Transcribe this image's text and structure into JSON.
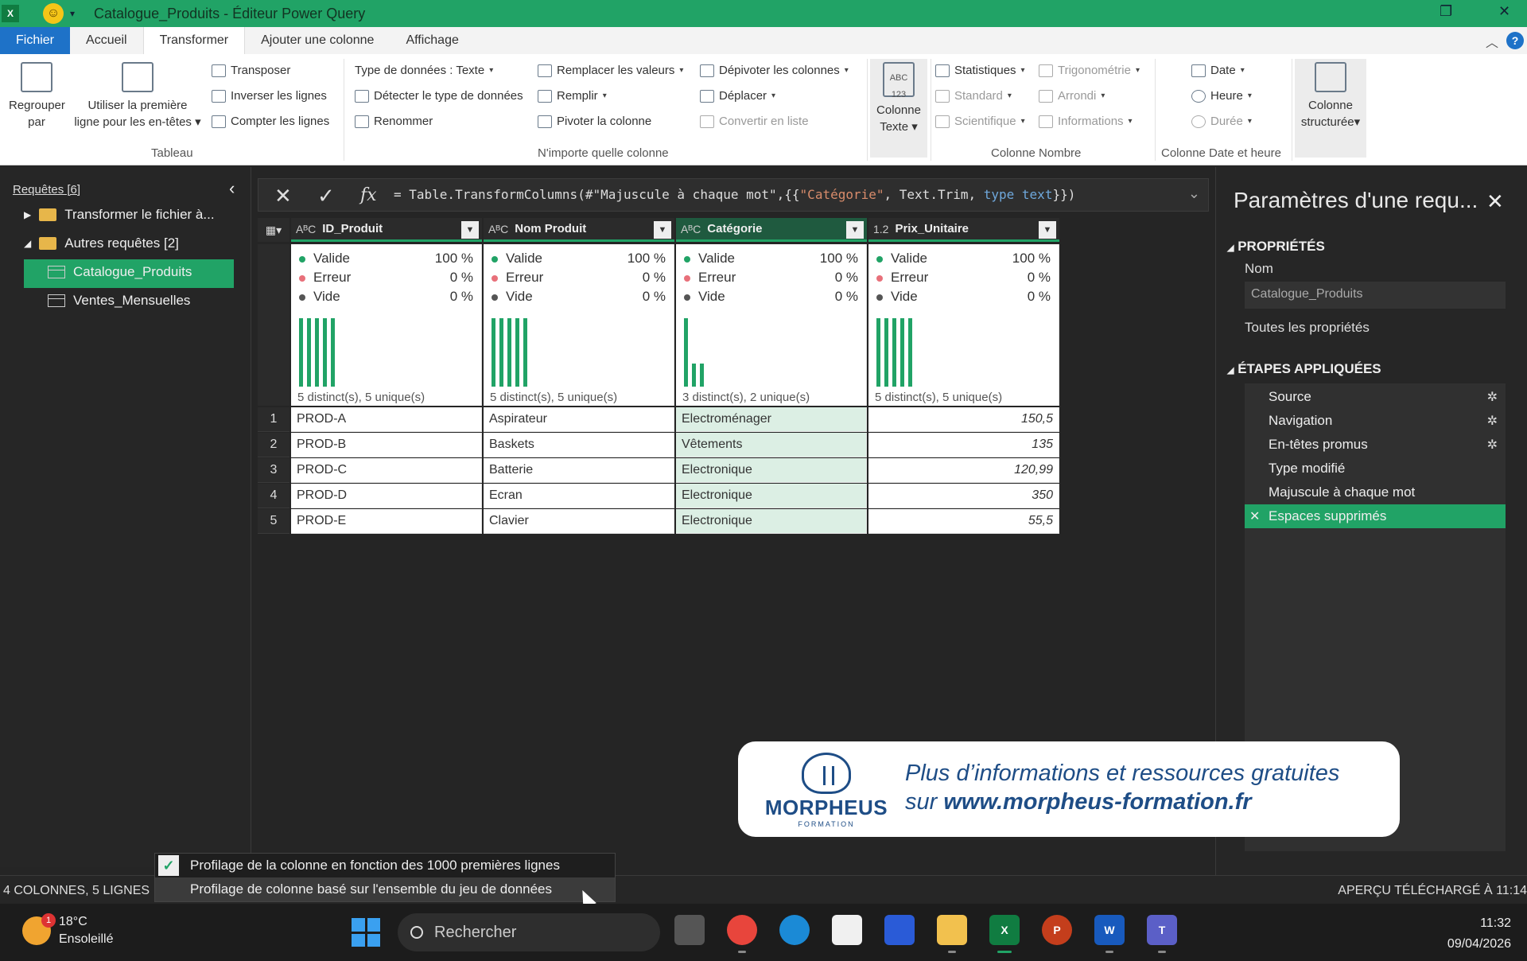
{
  "window": {
    "title": "Catalogue_Produits - Éditeur Power Query"
  },
  "tabs": [
    "Fichier",
    "Accueil",
    "Transformer",
    "Ajouter une colonne",
    "Affichage"
  ],
  "ribbon": {
    "regrouper": "Regrouper par",
    "premiere_ligne_1": "Utiliser la première",
    "premiere_ligne_2": "ligne pour les en-têtes",
    "transposer": "Transposer",
    "inverser": "Inverser les lignes",
    "compter": "Compter les lignes",
    "group_tableau": "Tableau",
    "type_donnees": "Type de données : Texte",
    "detecter": "Détecter le type de données",
    "renommer": "Renommer",
    "remplacer": "Remplacer les valeurs",
    "remplir": "Remplir",
    "pivoter": "Pivoter la colonne",
    "depivoter": "Dépivoter les colonnes",
    "deplacer": "Déplacer",
    "convertir": "Convertir en liste",
    "group_any": "N'importe quelle colonne",
    "colonne_texte_1": "Colonne",
    "colonne_texte_2": "Texte",
    "statistiques": "Statistiques",
    "standard": "Standard",
    "scientifique": "Scientifique",
    "trigonometrie": "Trigonométrie",
    "arrondi": "Arrondi",
    "informations": "Informations",
    "group_nombre": "Colonne Nombre",
    "date": "Date",
    "heure": "Heure",
    "duree": "Durée",
    "group_date": "Colonne Date et heure",
    "structuree_1": "Colonne",
    "structuree_2": "structurée"
  },
  "queries": {
    "header": "Requêtes [6]",
    "items": [
      {
        "label": "Transformer le fichier à..."
      },
      {
        "label": "Autres requêtes [2]"
      },
      {
        "label": "Catalogue_Produits"
      },
      {
        "label": "Ventes_Mensuelles"
      }
    ]
  },
  "formula": {
    "p1": "= Table.TransformColumns(#\"Majuscule à chaque mot\",{{",
    "s1": "\"Catégorie\"",
    "p2": ", Text.Trim, ",
    "kw": "type text",
    "p3": "}})"
  },
  "columns": [
    {
      "type": "AᴮC",
      "name": "ID_Produit"
    },
    {
      "type": "AᴮC",
      "name": "Nom Produit"
    },
    {
      "type": "AᴮC",
      "name": "Catégorie"
    },
    {
      "type": "1.2",
      "name": "Prix_Unitaire"
    }
  ],
  "profile": {
    "labels": {
      "valid": "Valide",
      "error": "Erreur",
      "empty": "Vide"
    },
    "cols": [
      {
        "valid": "100 %",
        "error": "0 %",
        "empty": "0 %",
        "distinct": "5 distinct(s), 5 unique(s)",
        "bars": [
          1,
          1,
          1,
          1,
          1
        ]
      },
      {
        "valid": "100 %",
        "error": "0 %",
        "empty": "0 %",
        "distinct": "5 distinct(s), 5 unique(s)",
        "bars": [
          1,
          1,
          1,
          1,
          1
        ]
      },
      {
        "valid": "100 %",
        "error": "0 %",
        "empty": "0 %",
        "distinct": "3 distinct(s), 2 unique(s)",
        "bars": [
          3,
          1,
          1
        ]
      },
      {
        "valid": "100 %",
        "error": "0 %",
        "empty": "0 %",
        "distinct": "5 distinct(s), 5 unique(s)",
        "bars": [
          1,
          1,
          1,
          1,
          1
        ]
      }
    ]
  },
  "rows": [
    {
      "n": "1",
      "c": [
        "PROD-A",
        "Aspirateur",
        "Electroménager",
        "150,5"
      ]
    },
    {
      "n": "2",
      "c": [
        "PROD-B",
        "Baskets",
        "Vêtements",
        "135"
      ]
    },
    {
      "n": "3",
      "c": [
        "PROD-C",
        "Batterie",
        "Electronique",
        "120,99"
      ]
    },
    {
      "n": "4",
      "c": [
        "PROD-D",
        "Ecran",
        "Electronique",
        "350"
      ]
    },
    {
      "n": "5",
      "c": [
        "PROD-E",
        "Clavier",
        "Electronique",
        "55,5"
      ]
    }
  ],
  "settings": {
    "title": "Paramètres d'une requ...",
    "props": "PROPRIÉTÉS",
    "nom_label": "Nom",
    "nom_value": "Catalogue_Produits",
    "all_props": "Toutes les propriétés",
    "steps_title": "ÉTAPES APPLIQUÉES",
    "steps": [
      {
        "label": "Source"
      },
      {
        "label": "Navigation"
      },
      {
        "label": "En-têtes promus"
      },
      {
        "label": "Type modifié"
      },
      {
        "label": "Majuscule à chaque mot"
      },
      {
        "label": "Espaces supprimés"
      }
    ]
  },
  "banner": {
    "brand": "MORPHEUS",
    "sub": "FORMATION",
    "line1": "Plus d’informations et ressources gratuites",
    "line2_a": "sur ",
    "line2_b": "www.morpheus-formation.fr"
  },
  "status": {
    "left": "4 COLONNES, 5 LIGNES",
    "right": "APERÇU TÉLÉCHARGÉ À 11:14"
  },
  "profiling_menu": {
    "item1": "Profilage de la colonne en fonction des 1000 premières lignes",
    "item2": "Profilage de colonne basé sur l'ensemble du jeu de données"
  },
  "taskbar": {
    "temp": "18°C",
    "weather": "Ensoleillé",
    "badge": "1",
    "search": "Rechercher",
    "time": "11:32",
    "date": "09/04/2026"
  },
  "colors": {
    "accent": "#21a366",
    "file_tab": "#1e72c8",
    "brand": "#1e4d86"
  }
}
